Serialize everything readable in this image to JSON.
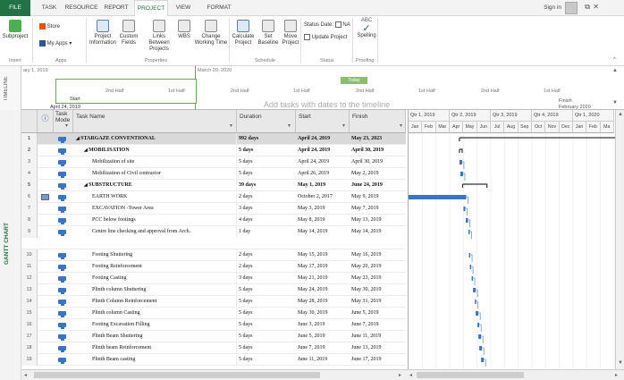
{
  "ribbon_tabs": [
    "FILE",
    "TASK",
    "RESOURCE",
    "REPORT",
    "PROJECT",
    "VIEW",
    "FORMAT"
  ],
  "account": {
    "sign_in": "Sign in"
  },
  "ribbon": {
    "insert": {
      "subproject": "Subproject",
      "group": "Insert"
    },
    "apps": {
      "store": "Store",
      "my_apps": "My Apps",
      "group": "Apps"
    },
    "properties": {
      "project_information": "Project Information",
      "custom_fields": "Custom Fields",
      "links_between_projects": "Links Between Projects",
      "wbs": "WBS",
      "change_working_time": "Change Working Time",
      "group": "Properties"
    },
    "schedule": {
      "calculate_project": "Calculate Project",
      "set_baseline": "Set Baseline",
      "move_project": "Move Project",
      "group": "Schedule"
    },
    "status": {
      "status_date_label": "Status Date:",
      "status_date_value": "NA",
      "update_project": "Update Project",
      "group": "Status"
    },
    "proofing": {
      "spelling": "Spelling",
      "abc": "ABC",
      "group": "Proofing"
    }
  },
  "timeline": {
    "side_label": "TIMELINE",
    "top_date_left": "ary 1, 2019",
    "top_date_mid": "March 20, 2020",
    "today": "Today",
    "start_label": "Start",
    "start_date": "April 24, 2019",
    "finish_label": "Finish",
    "finish_date": "February 2020",
    "half_labels": [
      "2nd Half",
      "1st Half",
      "2nd Half",
      "1st Half",
      "2nd Half",
      "1st Half",
      "2nd Half",
      "1st Half"
    ],
    "hint": "Add tasks with dates to the timeline"
  },
  "view_label": "GANTT CHART",
  "grid": {
    "columns": {
      "mode": "Task Mode",
      "name": "Task Name",
      "duration": "Duration",
      "start": "Start",
      "finish": "Finish"
    },
    "rows": [
      {
        "id": "1",
        "name": "STARGAZE CONVENTIONAL",
        "duration": "992 days",
        "start": "April 24, 2019",
        "finish": "May 23, 2023"
      },
      {
        "id": "2",
        "name": "MOBILISATION",
        "duration": "5 days",
        "start": "April 24, 2019",
        "finish": "April 30, 2019"
      },
      {
        "id": "3",
        "name": "Mobilization of site",
        "duration": "5 days",
        "start": "April 24, 2019",
        "finish": "April 30, 2019"
      },
      {
        "id": "4",
        "name": "Mobilization of Civil contractor",
        "duration": "5 days",
        "start": "April 26, 2019",
        "finish": "May 2, 2019"
      },
      {
        "id": "5",
        "name": "SUBSTRUCTURE",
        "duration": "39 days",
        "start": "May 1, 2019",
        "finish": "June 24, 2019"
      },
      {
        "id": "6",
        "name": "EARTH WORK",
        "duration": "2 days",
        "start": "October 2, 2017",
        "finish": "May 9, 2019"
      },
      {
        "id": "7",
        "name": "EXCAVATION -Tower Area",
        "duration": "3 days",
        "start": "May 3, 2019",
        "finish": "May 7, 2019"
      },
      {
        "id": "8",
        "name": "PCC below footings",
        "duration": "4 days",
        "start": "May 8, 2019",
        "finish": "May 13, 2019"
      },
      {
        "id": "9",
        "name": "Centre line checking and approval from Arch.",
        "duration": "1 day",
        "start": "May 14, 2019",
        "finish": "May 14, 2019"
      },
      {
        "id": "10",
        "name": "Footing Shuttering",
        "duration": "2 days",
        "start": "May 15, 2019",
        "finish": "May 16, 2019"
      },
      {
        "id": "11",
        "name": "Footing Reinforcement",
        "duration": "2 days",
        "start": "May 17, 2019",
        "finish": "May 20, 2019"
      },
      {
        "id": "12",
        "name": "Footing Casting",
        "duration": "3 days",
        "start": "May 21, 2019",
        "finish": "May 23, 2019"
      },
      {
        "id": "13",
        "name": "Plinth column Shuttering",
        "duration": "5 days",
        "start": "May 24, 2019",
        "finish": "May 30, 2019"
      },
      {
        "id": "14",
        "name": "Plinth Column Reinforcement",
        "duration": "5 days",
        "start": "May 28, 2019",
        "finish": "May 31, 2019"
      },
      {
        "id": "15",
        "name": "Plinth column Casting",
        "duration": "5 days",
        "start": "May 30, 2019",
        "finish": "June 5, 2019"
      },
      {
        "id": "16",
        "name": "Footing Excavation Filling",
        "duration": "5 days",
        "start": "June 3, 2019",
        "finish": "June 7, 2019"
      },
      {
        "id": "17",
        "name": "Plinth Beam Shuttering",
        "duration": "5 days",
        "start": "June 5, 2019",
        "finish": "June 11, 2019"
      },
      {
        "id": "18",
        "name": "Plinth beam Reinforcement",
        "duration": "5 days",
        "start": "June 7, 2019",
        "finish": "June 13, 2019"
      },
      {
        "id": "19",
        "name": "Plinth Beam casting",
        "duration": "5 days",
        "start": "June 11, 2019",
        "finish": "June 17, 2019"
      }
    ]
  },
  "gantt": {
    "quarters": [
      "Qtr 1, 2019",
      "Qtr 2, 2019",
      "Qtr 3, 2019",
      "Qtr 4, 2019",
      "Qtr 1, 2020"
    ],
    "months": [
      "Jan",
      "Feb",
      "Mar",
      "Apr",
      "May",
      "Jun",
      "Jul",
      "Aug",
      "Sep",
      "Oct",
      "Nov",
      "Dec",
      "Jan",
      "Feb",
      "Ma"
    ]
  },
  "colors": {
    "file_tab": "#217346",
    "bar": "#3a74c4",
    "summary_bar": "#333333"
  }
}
